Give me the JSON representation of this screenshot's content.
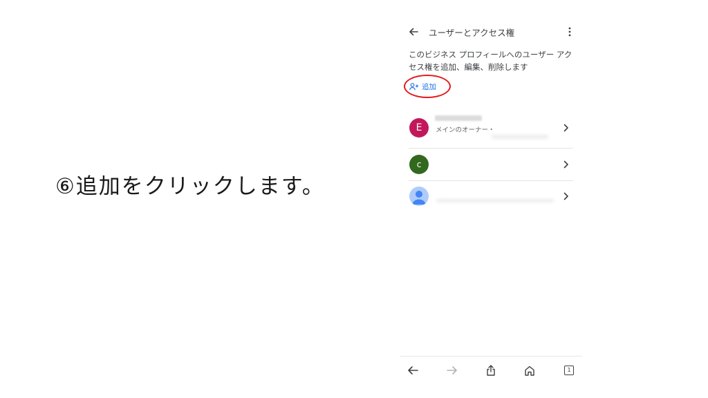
{
  "slide": {
    "instruction": "⑥追加をクリックします。"
  },
  "screen": {
    "appbar": {
      "title": "ユーザーとアクセス権",
      "back_icon": "arrow-left-icon",
      "menu_icon": "more-vert-icon"
    },
    "description": "このビジネス プロフィールへのユーザー アクセス権を追加、編集、削除します",
    "add_button": {
      "label": "追加",
      "icon": "person-add-icon",
      "highlight_color": "#e3191c"
    },
    "users": [
      {
        "initial": "E",
        "avatar_color": "#c2185b",
        "role": "メインのオーナー・"
      },
      {
        "initial": "c",
        "avatar_color": "#33691e",
        "role": ""
      },
      {
        "initial": "",
        "avatar_color": "#aecbfa",
        "avatar_icon": "default-avatar-icon",
        "role": ""
      }
    ],
    "bottom_nav": [
      "back-arrow-icon",
      "forward-arrow-icon",
      "share-icon",
      "home-icon",
      "tabs-icon"
    ],
    "tab_count": "1"
  },
  "colors": {
    "accent": "#1a73e8",
    "text": "#3c4043",
    "divider": "#e3e3e3"
  }
}
